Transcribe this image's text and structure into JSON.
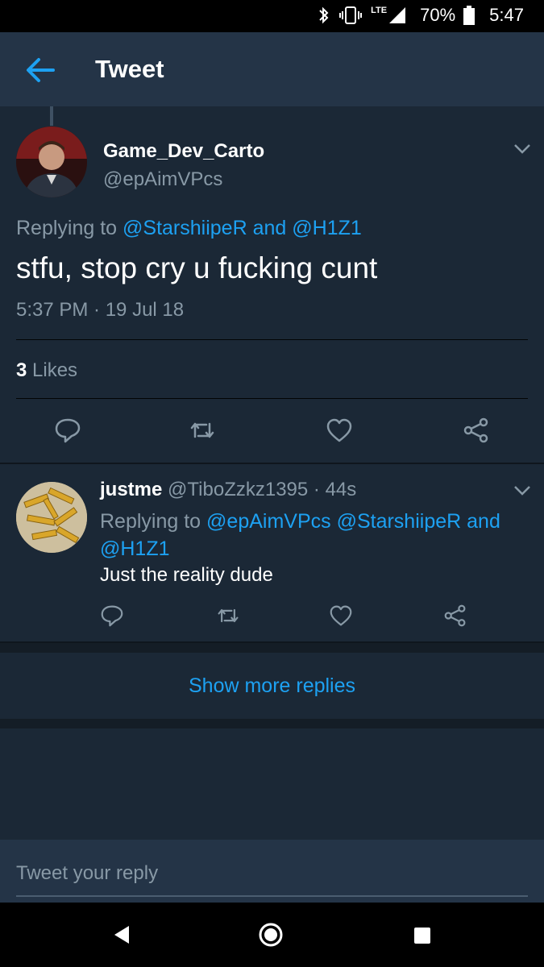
{
  "status_bar": {
    "network": "LTE",
    "battery": "70%",
    "time": "5:47",
    "icons": [
      "bluetooth-icon",
      "vibrate-icon",
      "signal-icon",
      "battery-icon"
    ]
  },
  "header": {
    "title": "Tweet"
  },
  "main_tweet": {
    "name": "Game_Dev_Carto",
    "handle": "@epAimVPcs",
    "replying_prefix": "Replying to",
    "replying_user1": "@StarshiipeR",
    "replying_and": "and",
    "replying_user2": "@H1Z1",
    "body": "stfu, stop cry u fucking cunt",
    "timestamp": "5:37 PM · 19 Jul 18",
    "likes_count": "3",
    "likes_label": "Likes"
  },
  "reply": {
    "name": "justme",
    "handle": "@TiboZzkz1395",
    "time": "· 44s",
    "replying_prefix": "Replying to",
    "replying_user1": "@epAimVPcs",
    "replying_user2": "@StarshiipeR",
    "replying_and": "and",
    "replying_user3": "@H1Z1",
    "body": "Just the reality dude"
  },
  "show_more": "Show more replies",
  "composer": {
    "placeholder": "Tweet your reply"
  },
  "colors": {
    "background": "#141d26",
    "card": "#1b2836",
    "appbar": "#243447",
    "accent": "#1da1f2",
    "muted": "#8899a6"
  }
}
